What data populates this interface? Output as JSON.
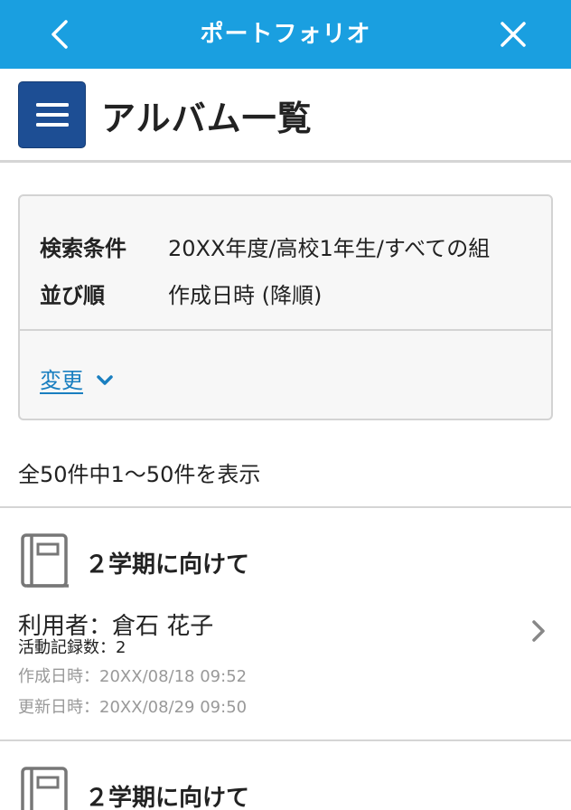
{
  "topbar": {
    "title": "ポートフォリオ"
  },
  "header": {
    "page_title": "アルバム一覧"
  },
  "search": {
    "condition_label": "検索条件",
    "condition_value": "20XX年度/高校1年生/すべての組",
    "order_label": "並び順",
    "order_value": "作成日時 (降順)",
    "change_label": "変更"
  },
  "result_count": "全50件中1〜50件を表示",
  "albums": [
    {
      "title": "２学期に向けて",
      "user": "利用者：倉石 花子",
      "activity_count": "活動記録数：2",
      "created": "作成日時：20XX/08/18 09:52",
      "updated": "更新日時：20XX/08/29 09:50"
    },
    {
      "title": "２学期に向けて"
    }
  ],
  "icons": {
    "back": "chevron-left-icon",
    "close": "close-icon",
    "menu": "hamburger-icon",
    "change": "chevron-down-icon",
    "album": "album-book-icon",
    "row_arrow": "chevron-right-icon"
  },
  "colors": {
    "topbar": "#1a9fe0",
    "menu_button": "#1d4e94",
    "link": "#1a7fc0",
    "muted_text": "#999999"
  }
}
